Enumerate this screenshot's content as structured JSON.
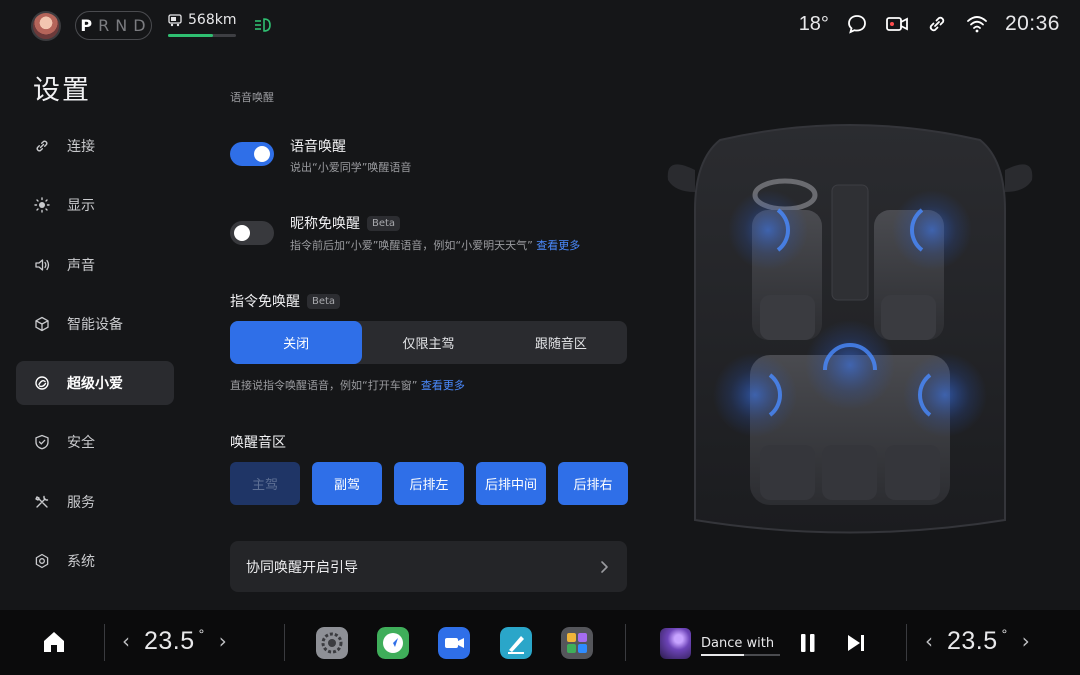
{
  "status_bar": {
    "gears": [
      "P",
      "R",
      "N",
      "D"
    ],
    "active_gear": "P",
    "range": "568km",
    "range_level": 0.66,
    "outside_temp": "18°",
    "time": "20:36",
    "icons": [
      "chat-icon",
      "camera-icon",
      "link-icon",
      "wifi-icon"
    ]
  },
  "sidebar": {
    "title": "设置",
    "items": [
      {
        "label": "连接",
        "icon": "link-icon"
      },
      {
        "label": "显示",
        "icon": "brightness-icon"
      },
      {
        "label": "声音",
        "icon": "speaker-icon"
      },
      {
        "label": "智能设备",
        "icon": "cube-icon"
      },
      {
        "label": "超级小爱",
        "icon": "assistant-icon",
        "active": true
      },
      {
        "label": "安全",
        "icon": "shield-icon"
      },
      {
        "label": "服务",
        "icon": "tools-icon"
      },
      {
        "label": "系统",
        "icon": "settings-icon"
      }
    ]
  },
  "main": {
    "section_label": "语音唤醒",
    "voice_wake": {
      "title": "语音唤醒",
      "desc": "说出“小爱同学”唤醒语音",
      "enabled": true
    },
    "nickname_wake": {
      "title": "昵称免唤醒",
      "badge": "Beta",
      "desc": "指令前后加“小爱”唤醒语音，例如“小爱明天天气”",
      "link": "查看更多",
      "enabled": false
    },
    "command_wake": {
      "title": "指令免唤醒",
      "badge": "Beta",
      "options": [
        "关闭",
        "仅限主驾",
        "跟随音区"
      ],
      "selected": "关闭",
      "desc": "直接说指令唤醒语音，例如“打开车窗”",
      "link": "查看更多"
    },
    "wake_zone": {
      "title": "唤醒音区",
      "zones": [
        "主驾",
        "副驾",
        "后排左",
        "后排中间",
        "后排右"
      ],
      "disabled": [
        "主驾"
      ]
    },
    "guide_label": "协同唤醒开启引导"
  },
  "dock": {
    "left_temp": "23.5",
    "right_temp": "23.5",
    "degree": "°",
    "apps": [
      "settings-app-icon",
      "maps-app-icon",
      "video-call-app-icon",
      "notes-app-icon",
      "app-folder-icon"
    ],
    "media_title": "Dance with",
    "media_progress": 0.55
  },
  "colors": {
    "accent": "#2f6fe8",
    "link": "#4b8bff",
    "background": "#151618",
    "battery": "#2fbf71"
  }
}
